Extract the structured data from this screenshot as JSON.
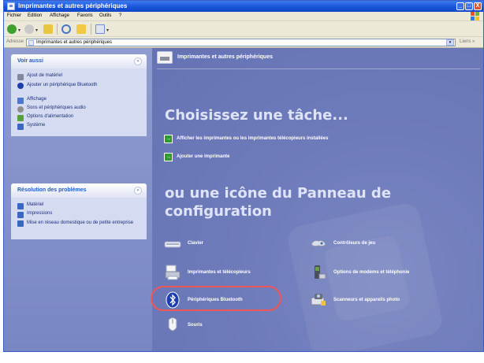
{
  "window": {
    "title": "Imprimantes et autres périphériques",
    "controls": [
      "_",
      "□",
      "X"
    ]
  },
  "menubar": {
    "items": [
      "Fichier",
      "Edition",
      "Affichage",
      "Favoris",
      "Outils",
      "?"
    ]
  },
  "address": {
    "label": "Adresse",
    "value": "Imprimantes et autres périphériques",
    "go_label": "Liens »",
    "dropdown": "▾"
  },
  "sidebar": {
    "see_also": {
      "title": "Voir aussi",
      "collapse_glyph": "«",
      "items": [
        {
          "label": "Ajout de matériel",
          "icon": "hardware-icon"
        },
        {
          "label": "Ajouter un périphérique Bluetooth",
          "icon": "bluetooth-icon"
        },
        {
          "label": "Affichage",
          "icon": "display-icon"
        },
        {
          "label": "Sons et périphériques audio",
          "icon": "sound-icon"
        },
        {
          "label": "Options d'alimentation",
          "icon": "power-icon"
        },
        {
          "label": "Système",
          "icon": "system-icon"
        }
      ]
    },
    "troubleshoot": {
      "title": "Résolution des problèmes",
      "collapse_glyph": "«",
      "items": [
        {
          "label": "Matériel",
          "icon": "help-icon"
        },
        {
          "label": "Impressions",
          "icon": "help-icon"
        },
        {
          "label": "Mise en réseau domestique ou de petite entreprise",
          "icon": "help-icon"
        }
      ]
    }
  },
  "main": {
    "header": "Imprimantes et autres périphériques",
    "task_heading": "Choisissez une tâche...",
    "tasks": [
      "Afficher les imprimantes ou les imprimantes télécopieurs installées",
      "Ajouter une imprimante"
    ],
    "cp_heading_line1": "ou une icône du Panneau de",
    "cp_heading_line2": "configuration",
    "icons": [
      {
        "label": "Clavier",
        "icon": "keyboard-icon"
      },
      {
        "label": "Contrôleurs de jeu",
        "icon": "game-controller-icon"
      },
      {
        "label": "Imprimantes et télécopieurs",
        "icon": "printer-icon"
      },
      {
        "label": "Options de modems et téléphonie",
        "icon": "phone-icon"
      },
      {
        "label": "Périphériques Bluetooth",
        "icon": "bluetooth-icon"
      },
      {
        "label": "Scanneurs et appareils photo",
        "icon": "scanner-icon"
      },
      {
        "label": "Souris",
        "icon": "mouse-icon"
      }
    ]
  },
  "colors": {
    "highlight": "#ef5656",
    "main_bg": "#6e7bbb",
    "sidebar_bg": "#7886c4",
    "titlebar": "#1a56d8"
  }
}
